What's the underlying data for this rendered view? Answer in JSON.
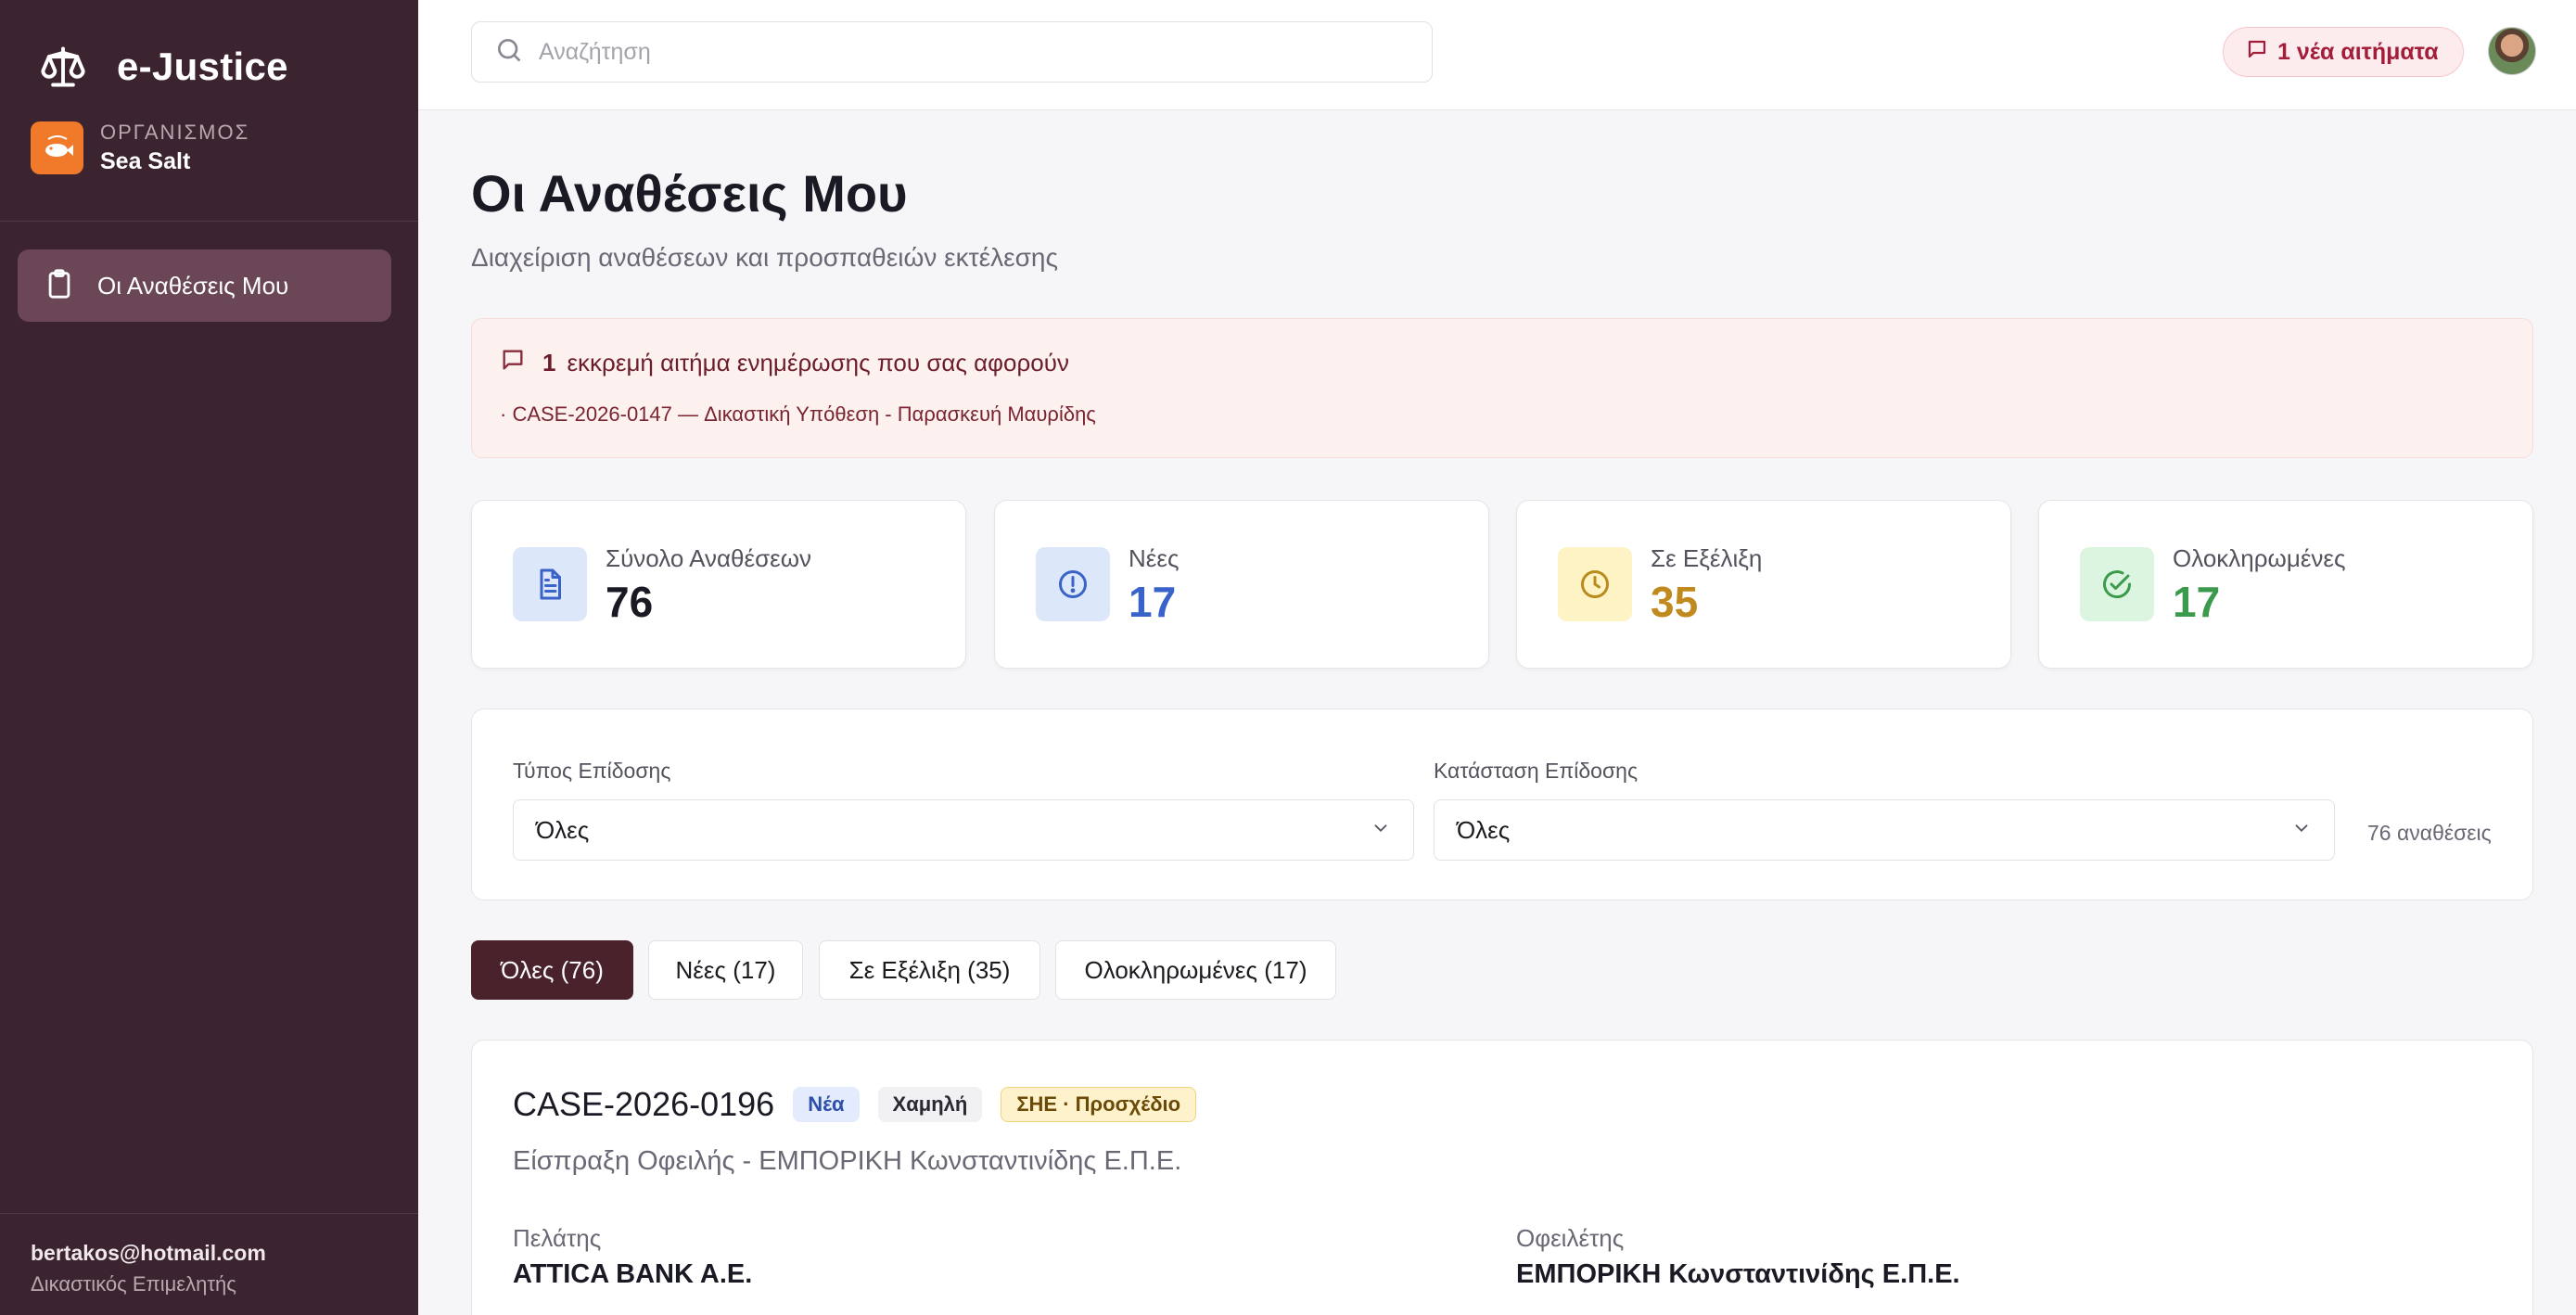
{
  "app": {
    "title": "e-Justice"
  },
  "organization": {
    "label": "ΟΡΓΑΝΙΣΜΟΣ",
    "name": "Sea Salt"
  },
  "sidebar": {
    "items": [
      {
        "label": "Οι Αναθέσεις Μου",
        "icon": "clipboard-icon",
        "active": true
      }
    ]
  },
  "user": {
    "email": "bertakos@hotmail.com",
    "role": "Δικαστικός Επιμελητής"
  },
  "search": {
    "placeholder": "Αναζήτηση",
    "value": ""
  },
  "requests_badge": {
    "label": "1 νέα αιτήματα",
    "icon": "message-icon"
  },
  "page": {
    "title": "Οι Αναθέσεις Μου",
    "subtitle": "Διαχείριση αναθέσεων και προσπαθειών εκτέλεσης"
  },
  "alert": {
    "count": "1",
    "text": "εκκρεμή αιτήμα ενημέρωσης που σας αφορούν",
    "item": "· CASE-2026-0147 — Δικαστική Υπόθεση - Παρασκευή Μαυρίδης"
  },
  "stats": [
    {
      "label": "Σύνολο Αναθέσεων",
      "value": "76",
      "icon": "document-icon",
      "color": "#1a1a24",
      "bg": "#dde7fa",
      "icon_color": "#3a63c9"
    },
    {
      "label": "Νέες",
      "value": "17",
      "icon": "alert-circle-icon",
      "color": "#3a63c9",
      "bg": "#dde7fa",
      "icon_color": "#3a63c9"
    },
    {
      "label": "Σε Εξέλιξη",
      "value": "35",
      "icon": "clock-icon",
      "color": "#c08a1e",
      "bg": "#fdf3c4",
      "icon_color": "#b98b1c"
    },
    {
      "label": "Ολοκληρωμένες",
      "value": "17",
      "icon": "check-circle-icon",
      "color": "#3b9a4c",
      "bg": "#dcf5e1",
      "icon_color": "#3b9a4c"
    }
  ],
  "filters": {
    "type": {
      "label": "Τύπος Επίδοσης",
      "value": "Όλες"
    },
    "status": {
      "label": "Κατάσταση Επίδοσης",
      "value": "Όλες"
    },
    "count": "76 αναθέσεις"
  },
  "tabs": [
    {
      "label": "Όλες (76)",
      "active": true
    },
    {
      "label": "Νέες (17)",
      "active": false
    },
    {
      "label": "Σε Εξέλιξη (35)",
      "active": false
    },
    {
      "label": "Ολοκληρωμένες (17)",
      "active": false
    }
  ],
  "cases": [
    {
      "id": "CASE-2026-0196",
      "status": "Νέα",
      "priority": "Χαμηλή",
      "type": "ΣΗΕ · Προσχέδιο",
      "description": "Είσπραξη Οφειλής - ΕΜΠΟΡΙΚΗ Κωνσταντινίδης Ε.Π.Ε.",
      "client_label": "Πελάτης",
      "client": "ATTICA BANK A.E.",
      "debtor_label": "Οφειλέτης",
      "debtor": "ΕΜΠΟΡΙΚΗ Κωνσταντινίδης Ε.Π.Ε."
    }
  ]
}
